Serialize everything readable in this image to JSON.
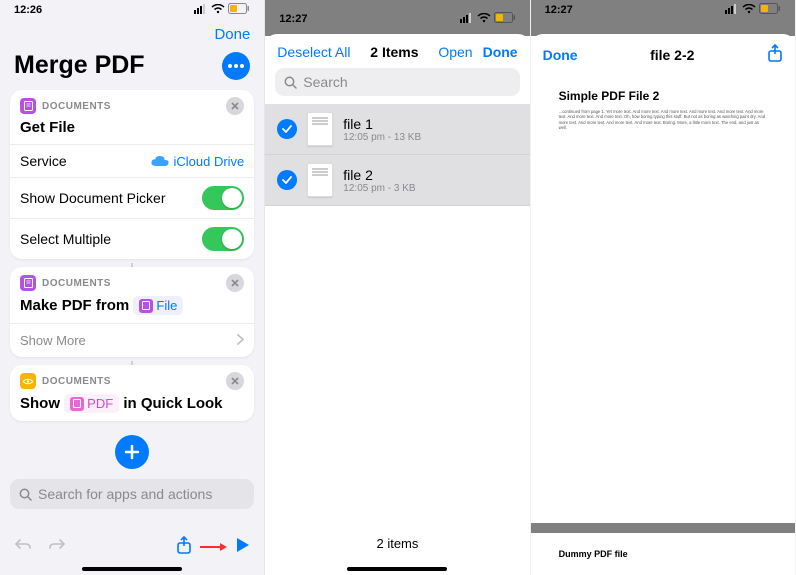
{
  "panel1": {
    "time": "12:26",
    "nav": {
      "done": "Done"
    },
    "title": "Merge PDF",
    "card1": {
      "category": "DOCUMENTS",
      "title": "Get File",
      "rows": {
        "service_label": "Service",
        "service_value": "iCloud Drive",
        "picker_label": "Show Document Picker",
        "multi_label": "Select Multiple"
      }
    },
    "card2": {
      "category": "DOCUMENTS",
      "line_prefix": "Make PDF from",
      "pill": "File",
      "show_more": "Show More"
    },
    "card3": {
      "category": "DOCUMENTS",
      "line_prefix": "Show",
      "pill": "PDF",
      "line_suffix": "in Quick Look"
    },
    "search_placeholder": "Search for apps and actions"
  },
  "panel2": {
    "time": "12:27",
    "nav": {
      "deselect": "Deselect All",
      "count": "2 Items",
      "open": "Open",
      "done": "Done"
    },
    "search_placeholder": "Search",
    "files": [
      {
        "name": "file 1",
        "meta": "12:05 pm - 13 KB"
      },
      {
        "name": "file 2",
        "meta": "12:05 pm - 3 KB"
      }
    ],
    "footer": "2 items"
  },
  "panel3": {
    "time": "12:27",
    "nav": {
      "done": "Done",
      "title": "file 2-2"
    },
    "page1_title": "Simple PDF File 2",
    "page1_body": "...continued from page 1. Yet more text. And more text. And more text. And more text. And more text. And more text. And more text. And more text. Oh, how boring typing this stuff. But not as boring as watching paint dry. And more text. And more text. And more text. And more text. Boring. More, a little more text. The end, and just as well.",
    "page2_title": "Dummy PDF file"
  }
}
